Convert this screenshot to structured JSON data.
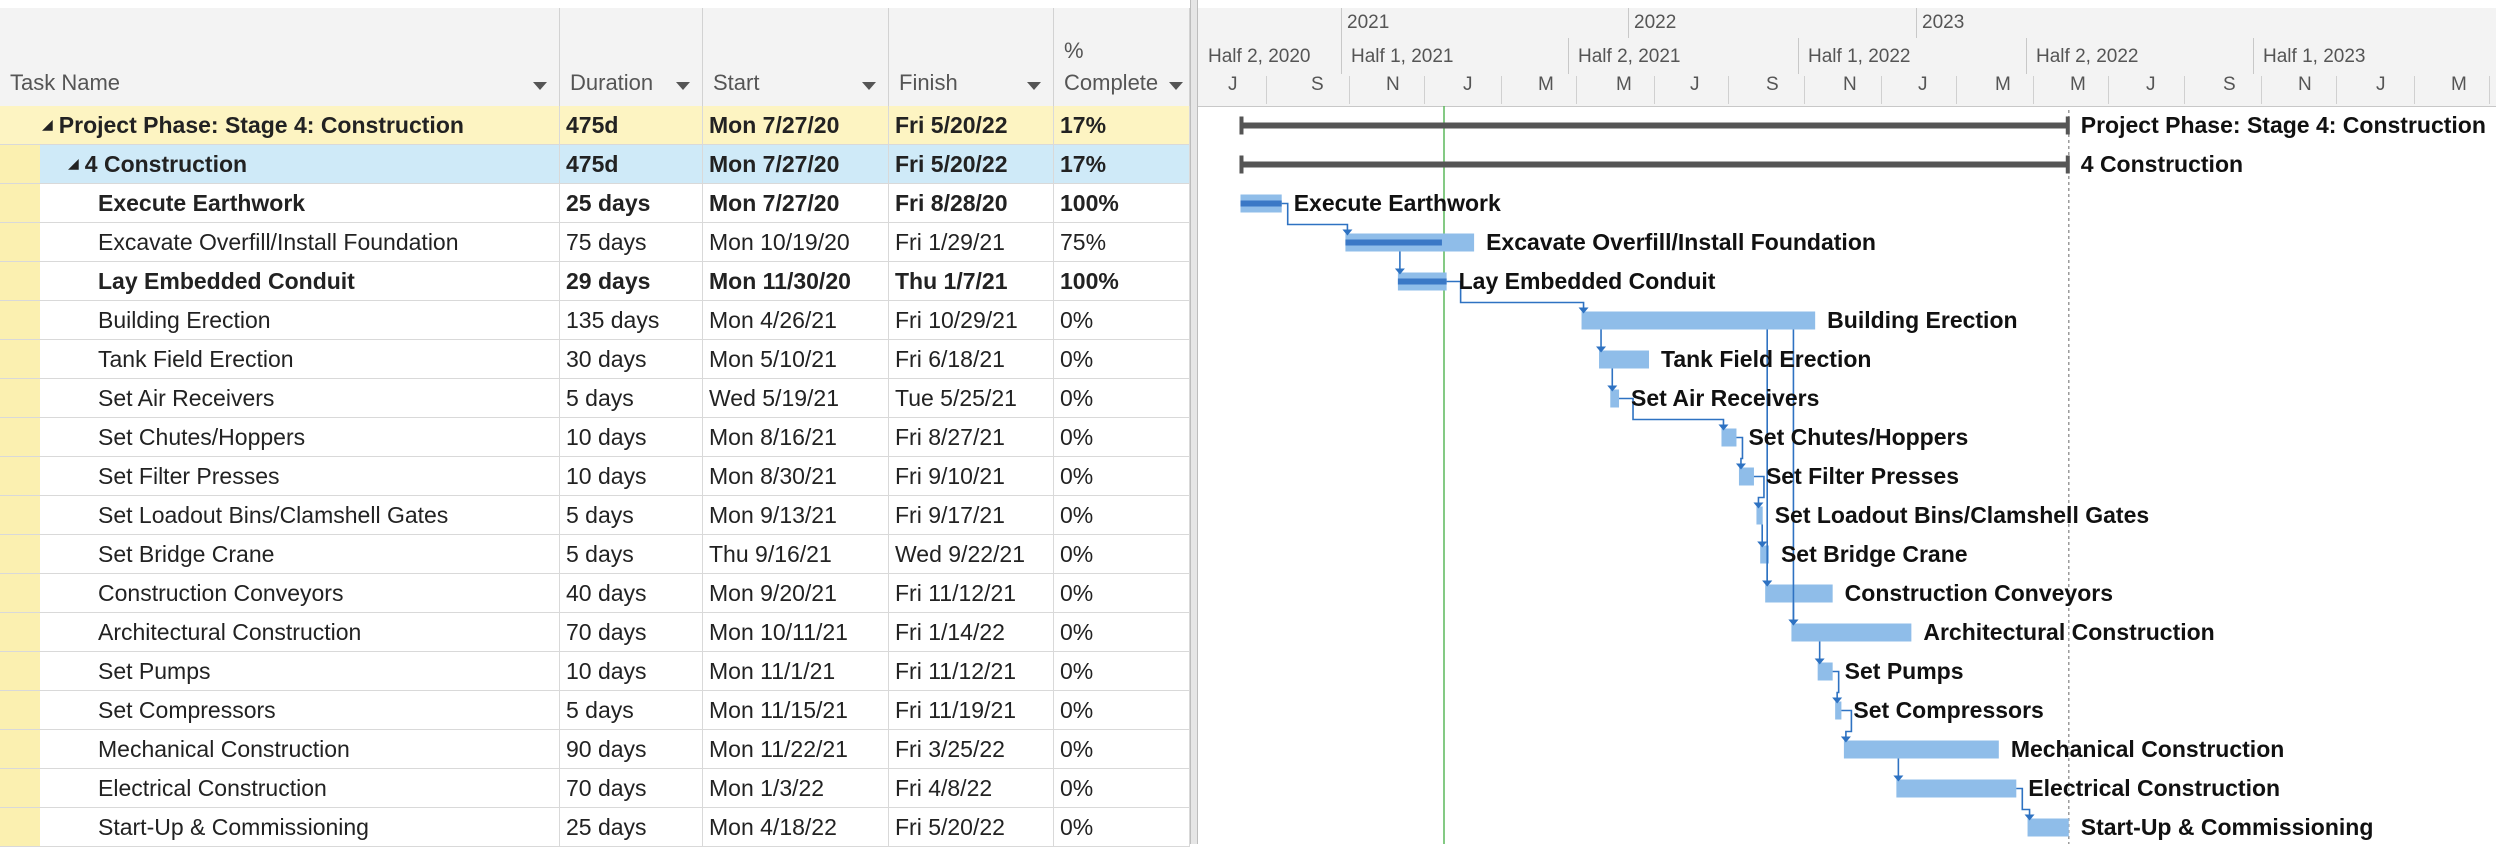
{
  "columns": {
    "task_name": "Task Name",
    "duration": "Duration",
    "start": "Start",
    "finish": "Finish",
    "complete_top": "%",
    "complete_bottom": "Complete"
  },
  "timescale": {
    "years": [
      "2021",
      "2022",
      "2023"
    ],
    "halves": [
      "Half 2, 2020",
      "Half 1, 2021",
      "Half 2, 2021",
      "Half 1, 2022",
      "Half 2, 2022",
      "Half 1, 2023"
    ],
    "months": [
      "J",
      "S",
      "N",
      "J",
      "M",
      "M",
      "J",
      "S",
      "N",
      "J",
      "M",
      "M",
      "J",
      "S",
      "N",
      "J",
      "M"
    ]
  },
  "tasks": [
    {
      "name": "Project Phase: Stage 4: Construction",
      "duration": "475d",
      "start": "Mon 7/27/20",
      "finish": "Fri 5/20/22",
      "complete": "17%",
      "level": 0,
      "type": "summary",
      "bold": true,
      "bar_label": "Project Phase: Stage 4: Construction"
    },
    {
      "name": "4  Construction",
      "duration": "475d",
      "start": "Mon 7/27/20",
      "finish": "Fri 5/20/22",
      "complete": "17%",
      "level": 1,
      "type": "summary",
      "bold": true,
      "bar_label": "4  Construction"
    },
    {
      "name": "Execute Earthwork",
      "duration": "25 days",
      "start": "Mon 7/27/20",
      "finish": "Fri 8/28/20",
      "complete": "100%",
      "level": 2,
      "type": "task",
      "bold": true,
      "bar_label": "Execute Earthwork",
      "progress": 1.0
    },
    {
      "name": "Excavate Overfill/Install Foundation",
      "duration": "75 days",
      "start": "Mon 10/19/20",
      "finish": "Fri 1/29/21",
      "complete": "75%",
      "level": 2,
      "type": "task",
      "bold": false,
      "bar_label": "Excavate Overfill/Install Foundation",
      "progress": 0.75
    },
    {
      "name": "Lay Embedded Conduit",
      "duration": "29 days",
      "start": "Mon 11/30/20",
      "finish": "Thu 1/7/21",
      "complete": "100%",
      "level": 2,
      "type": "task",
      "bold": true,
      "bar_label": "Lay Embedded Conduit",
      "progress": 1.0
    },
    {
      "name": "Building Erection",
      "duration": "135 days",
      "start": "Mon 4/26/21",
      "finish": "Fri 10/29/21",
      "complete": "0%",
      "level": 2,
      "type": "task",
      "bold": false,
      "bar_label": "Building Erection",
      "progress": 0
    },
    {
      "name": "Tank Field Erection",
      "duration": "30 days",
      "start": "Mon 5/10/21",
      "finish": "Fri 6/18/21",
      "complete": "0%",
      "level": 2,
      "type": "task",
      "bold": false,
      "bar_label": "Tank Field Erection",
      "progress": 0
    },
    {
      "name": "Set Air Receivers",
      "duration": "5 days",
      "start": "Wed 5/19/21",
      "finish": "Tue 5/25/21",
      "complete": "0%",
      "level": 2,
      "type": "task",
      "bold": false,
      "bar_label": "Set Air Receivers",
      "progress": 0
    },
    {
      "name": "Set Chutes/Hoppers",
      "duration": "10 days",
      "start": "Mon 8/16/21",
      "finish": "Fri 8/27/21",
      "complete": "0%",
      "level": 2,
      "type": "task",
      "bold": false,
      "bar_label": "Set Chutes/Hoppers",
      "progress": 0
    },
    {
      "name": "Set Filter Presses",
      "duration": "10 days",
      "start": "Mon 8/30/21",
      "finish": "Fri 9/10/21",
      "complete": "0%",
      "level": 2,
      "type": "task",
      "bold": false,
      "bar_label": "Set Filter Presses",
      "progress": 0
    },
    {
      "name": "Set Loadout Bins/Clamshell Gates",
      "duration": "5 days",
      "start": "Mon 9/13/21",
      "finish": "Fri 9/17/21",
      "complete": "0%",
      "level": 2,
      "type": "task",
      "bold": false,
      "bar_label": "Set Loadout Bins/Clamshell Gates",
      "progress": 0
    },
    {
      "name": "Set Bridge Crane",
      "duration": "5 days",
      "start": "Thu 9/16/21",
      "finish": "Wed 9/22/21",
      "complete": "0%",
      "level": 2,
      "type": "task",
      "bold": false,
      "bar_label": "Set Bridge Crane",
      "progress": 0
    },
    {
      "name": "Construction Conveyors",
      "duration": "40 days",
      "start": "Mon 9/20/21",
      "finish": "Fri 11/12/21",
      "complete": "0%",
      "level": 2,
      "type": "task",
      "bold": false,
      "bar_label": "Construction Conveyors",
      "progress": 0
    },
    {
      "name": "Architectural Construction",
      "duration": "70 days",
      "start": "Mon 10/11/21",
      "finish": "Fri 1/14/22",
      "complete": "0%",
      "level": 2,
      "type": "task",
      "bold": false,
      "bar_label": "Architectural Construction",
      "progress": 0
    },
    {
      "name": "Set Pumps",
      "duration": "10 days",
      "start": "Mon 11/1/21",
      "finish": "Fri 11/12/21",
      "complete": "0%",
      "level": 2,
      "type": "task",
      "bold": false,
      "bar_label": "Set Pumps",
      "progress": 0
    },
    {
      "name": "Set Compressors",
      "duration": "5 days",
      "start": "Mon 11/15/21",
      "finish": "Fri 11/19/21",
      "complete": "0%",
      "level": 2,
      "type": "task",
      "bold": false,
      "bar_label": "Set Compressors",
      "progress": 0
    },
    {
      "name": "Mechanical Construction",
      "duration": "90 days",
      "start": "Mon 11/22/21",
      "finish": "Fri 3/25/22",
      "complete": "0%",
      "level": 2,
      "type": "task",
      "bold": false,
      "bar_label": "Mechanical Construction",
      "progress": 0
    },
    {
      "name": "Electrical Construction",
      "duration": "70 days",
      "start": "Mon 1/3/22",
      "finish": "Fri 4/8/22",
      "complete": "0%",
      "level": 2,
      "type": "task",
      "bold": false,
      "bar_label": "Electrical Construction",
      "progress": 0
    },
    {
      "name": "Start-Up & Commissioning",
      "duration": "25 days",
      "start": "Mon 4/18/22",
      "finish": "Fri 5/20/22",
      "complete": "0%",
      "level": 2,
      "type": "task",
      "bold": false,
      "bar_label": "Start-Up & Commissioning",
      "progress": 0
    }
  ],
  "colors": {
    "summary_row": "#fdf4c2",
    "selected_row": "#cfeaf8",
    "bar": "#8fbde9",
    "progress": "#3a78c6",
    "summary_bar": "#555555",
    "link": "#2e72c2",
    "status_line": "#5cb85c"
  }
}
